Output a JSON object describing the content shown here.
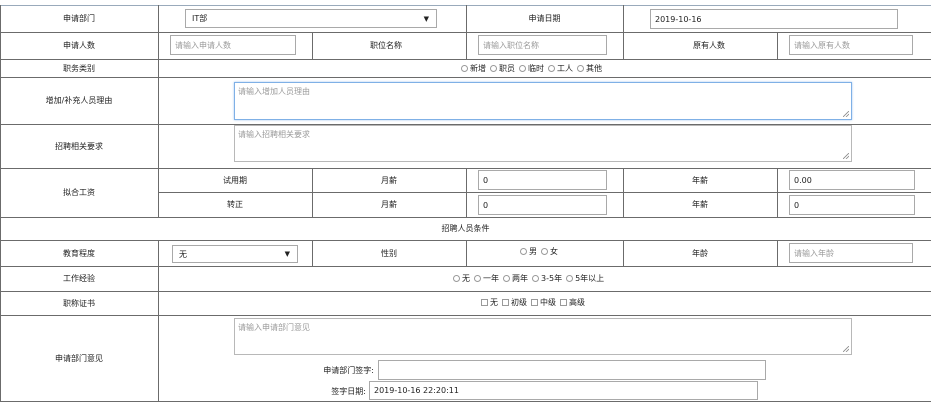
{
  "row_apply": {
    "dept_label": "申请部门",
    "dept_value": "IT部",
    "date_label": "申请日期",
    "date_value": "2019-10-16"
  },
  "row_counts": {
    "applicants_label": "申请人数",
    "applicants_placeholder": "请输入申请人数",
    "position_label": "职位名称",
    "position_placeholder": "请输入职位名称",
    "existing_label": "原有人数",
    "existing_placeholder": "请输入原有人数"
  },
  "row_category": {
    "label": "职务类别",
    "options": [
      "新增",
      "职员",
      "临时",
      "工人",
      "其他"
    ]
  },
  "row_reason": {
    "label": "增加/补充人员理由",
    "placeholder": "请输入增加人员理由"
  },
  "row_requirements": {
    "label": "招聘相关要求",
    "placeholder": "请输入招聘相关要求"
  },
  "row_salary": {
    "label": "拟合工资",
    "trial_label": "试用期",
    "regular_label": "转正",
    "monthly_label": "月薪",
    "annual_label": "年薪",
    "trial_monthly": "0",
    "trial_annual": "0.00",
    "regular_monthly": "0",
    "regular_annual": "0"
  },
  "section_conditions": "招聘人员条件",
  "row_education": {
    "label": "教育程度",
    "value": "无",
    "gender_label": "性别",
    "gender_options": [
      "男",
      "女"
    ],
    "age_label": "年龄",
    "age_placeholder": "请输入年龄"
  },
  "row_experience": {
    "label": "工作经验",
    "options": [
      "无",
      "一年",
      "两年",
      "3-5年",
      "5年以上"
    ]
  },
  "row_certificate": {
    "label": "职称证书",
    "options": [
      "无",
      "初级",
      "中级",
      "高级"
    ]
  },
  "row_opinion": {
    "label": "申请部门意见",
    "placeholder": "请输入申请部门意见",
    "signature_label": "申请部门签字:",
    "signature_value": "",
    "sign_date_label": "签字日期:",
    "sign_date_value": "2019-10-16 22:20:11"
  },
  "icons": {
    "caret": "▼",
    "grip": "resize-grip-icon"
  }
}
